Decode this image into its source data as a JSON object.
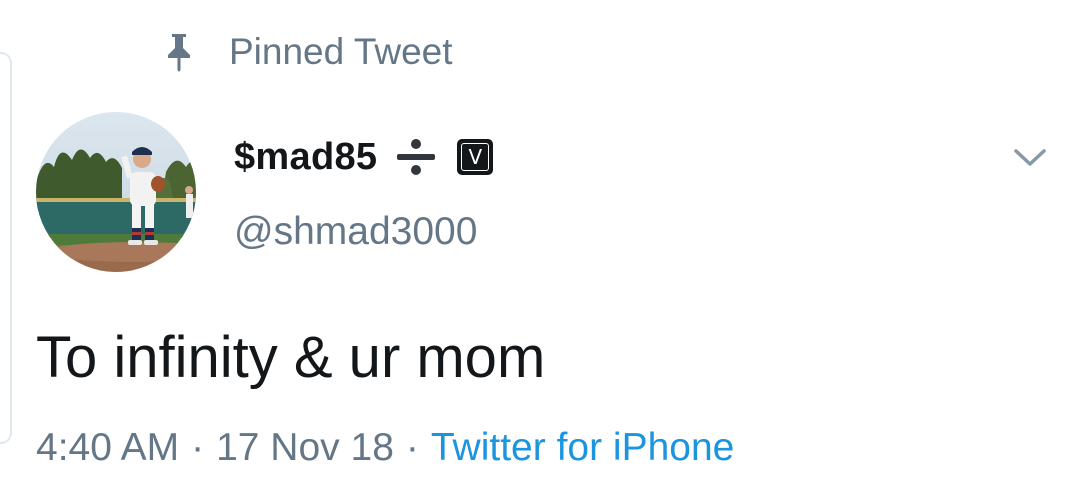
{
  "pinned": {
    "label": "Pinned Tweet",
    "icon": "pin-icon"
  },
  "author": {
    "display_name": "$mad85",
    "emoji": "divide-sign-emoji",
    "badge_text": "V",
    "handle": "@shmad3000"
  },
  "tweet": {
    "text": "To infinity & ur mom",
    "time": "4:40 AM",
    "date": "17 Nov 18",
    "separator": "·",
    "source": "Twitter for iPhone"
  },
  "colors": {
    "text_primary": "#14171a",
    "text_secondary": "#657786",
    "link": "#1b95e0",
    "border": "#e1e8ed"
  },
  "icons": [
    "pin-icon",
    "chevron-down-icon",
    "divide-sign-emoji",
    "v-badge-icon",
    "avatar"
  ]
}
